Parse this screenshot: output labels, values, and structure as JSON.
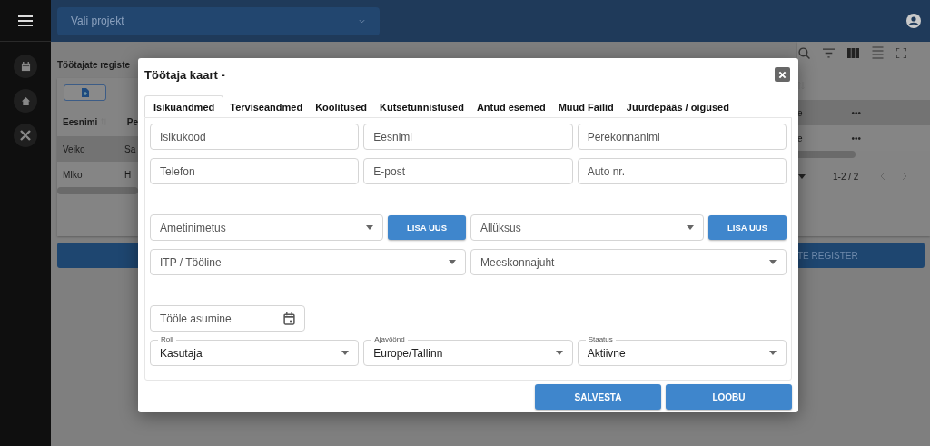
{
  "header": {
    "project_select": {
      "placeholder": "Vali projekt"
    }
  },
  "register": {
    "title": "Töötajate registe",
    "columns": [
      "Eesnimi",
      "Pe"
    ],
    "rows": [
      {
        "cells": [
          "Veiko",
          "Sa"
        ],
        "tail": [
          "e",
          "•••"
        ],
        "selected": true
      },
      {
        "cells": [
          "MIko",
          "H"
        ],
        "tail": [
          "e",
          "•••"
        ],
        "selected": false
      }
    ],
    "pagination": "1-2 / 2",
    "bottom_button": "TE REGISTER"
  },
  "dialog": {
    "title": "Töötaja kaart -",
    "tabs": [
      {
        "label": "Isikuandmed",
        "selected": true
      },
      {
        "label": "Terviseandmed",
        "selected": false
      },
      {
        "label": "Koolitused",
        "selected": false
      },
      {
        "label": "Kutsetunnistused",
        "selected": false
      },
      {
        "label": "Antud esemed",
        "selected": false
      },
      {
        "label": "Muud Failid",
        "selected": false
      },
      {
        "label": "Juurdepääs / õigused",
        "selected": false
      }
    ],
    "groups": [
      [
        [
          {
            "kind": "text",
            "placeholder": "Isikukood"
          },
          {
            "kind": "text",
            "placeholder": "Eesnimi"
          },
          {
            "kind": "text",
            "placeholder": "Perekonnanimi"
          }
        ],
        [
          {
            "kind": "text",
            "placeholder": "Telefon"
          },
          {
            "kind": "text",
            "placeholder": "E-post"
          },
          {
            "kind": "text",
            "placeholder": "Auto nr."
          }
        ]
      ],
      [
        [
          {
            "kind": "select",
            "placeholder": "Ametinimetus"
          },
          {
            "kind": "button",
            "label": "LISA UUS"
          },
          {
            "kind": "select",
            "placeholder": "Allüksus"
          },
          {
            "kind": "button",
            "label": "LISA UUS"
          }
        ],
        [
          {
            "kind": "select",
            "placeholder": "ITP / Tööline"
          },
          {
            "kind": "select",
            "placeholder": "Meeskonnajuht"
          }
        ]
      ],
      [
        [
          {
            "kind": "date",
            "placeholder": "Tööle asumine"
          }
        ],
        [
          {
            "kind": "labeled_select",
            "label": "Roll",
            "value": "Kasutaja"
          },
          {
            "kind": "labeled_select",
            "label": "Ajavöönd",
            "value": "Europe/Tallinn"
          },
          {
            "kind": "labeled_select",
            "label": "Staatus",
            "value": "Aktiivne"
          }
        ]
      ]
    ],
    "buttons": [
      "SALVESTA",
      "LOOBU"
    ]
  }
}
